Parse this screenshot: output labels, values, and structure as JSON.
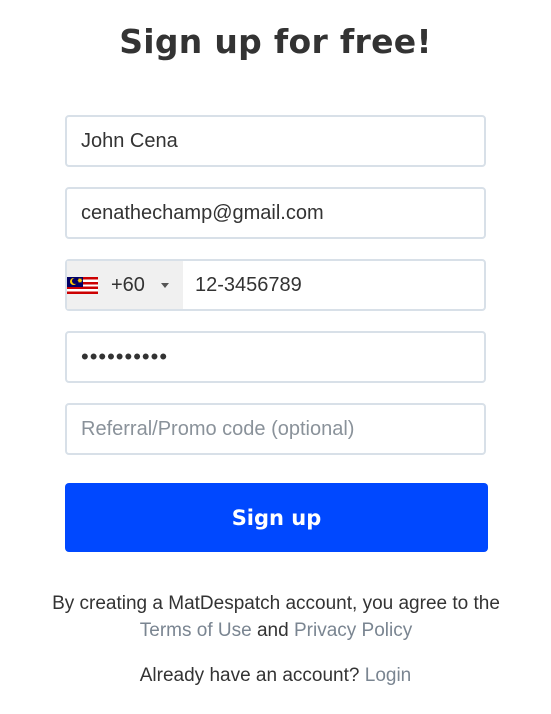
{
  "title": "Sign up for free!",
  "form": {
    "name_value": "John Cena",
    "email_value": "cenathechamp@gmail.com",
    "country_flag": "malaysia-flag-icon",
    "dial_code": "+60",
    "phone_value": "12-3456789",
    "password_value": "••••••••••",
    "promo_placeholder": "Referral/Promo code (optional)",
    "submit_label": "Sign up"
  },
  "terms": {
    "prefix": "By creating a MatDespatch account, you agree to the",
    "terms_link": "Terms of Use",
    "and": "and",
    "privacy_link": "Privacy Policy"
  },
  "login": {
    "prompt": "Already have an account?",
    "link": "Login"
  },
  "colors": {
    "primary_button": "#0048ff",
    "link": "#7a8591",
    "field_border": "#d8e0e8"
  }
}
